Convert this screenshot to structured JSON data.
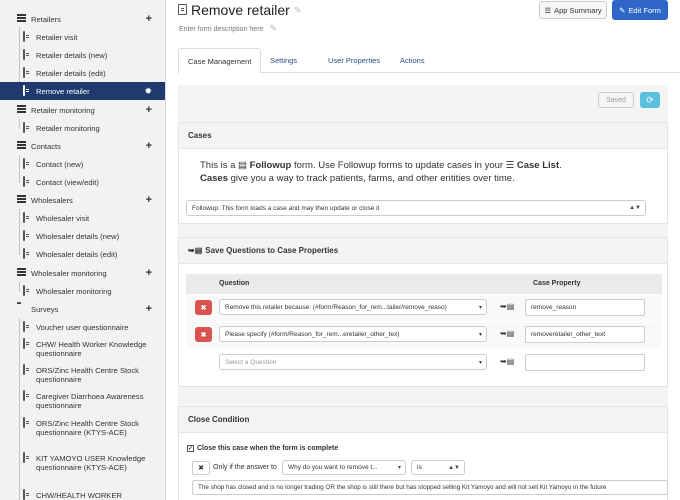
{
  "sidebar": {
    "items": [
      {
        "label": "Retailers",
        "type": "module"
      },
      {
        "label": "Retailer visit",
        "type": "form"
      },
      {
        "label": "Retailer details (new)",
        "type": "form"
      },
      {
        "label": "Retailer details (edit)",
        "type": "form"
      },
      {
        "label": "Remove retailer",
        "type": "form-active"
      },
      {
        "label": "Retailer monitoring",
        "type": "module"
      },
      {
        "label": "Retailer monitoring",
        "type": "form"
      },
      {
        "label": "Contacts",
        "type": "module"
      },
      {
        "label": "Contact (new)",
        "type": "form"
      },
      {
        "label": "Contact (view/edit)",
        "type": "form"
      },
      {
        "label": "Wholesalers",
        "type": "module"
      },
      {
        "label": "Wholesaler visit",
        "type": "form"
      },
      {
        "label": "Wholesaler details (new)",
        "type": "form"
      },
      {
        "label": "Wholesaler details (edit)",
        "type": "form"
      },
      {
        "label": "Wholesaler monitoring",
        "type": "module"
      },
      {
        "label": "Wholesaler monitoring",
        "type": "form"
      },
      {
        "label": "Surveys",
        "type": "folder"
      },
      {
        "label": "Voucher user questionnaire",
        "type": "form"
      },
      {
        "label": "CHW/ Health Worker Knowledge questionnaire",
        "type": "form"
      },
      {
        "label": "ORS/Zinc Health Centre Stock questionnaire",
        "type": "form"
      },
      {
        "label": "Caregiver Diarrhoea Awareness questionnaire",
        "type": "form"
      },
      {
        "label": "ORS/Zinc Health Centre Stock questionnaire (KTYS-ACE)",
        "type": "form"
      },
      {
        "label": "KIT YAMOYO USER Knowledge questionnaire (KTYS-ACE)",
        "type": "form"
      },
      {
        "label": "CHW/HEALTH WORKER",
        "type": "form"
      }
    ]
  },
  "header": {
    "title": "Remove retailer",
    "description_placeholder": "Enter form description here",
    "app_summary_label": "App Summary",
    "edit_form_label": "Edit Form"
  },
  "tabs": [
    {
      "label": "Case Management"
    },
    {
      "label": "Settings"
    },
    {
      "label": "User Properties"
    },
    {
      "label": "Actions"
    }
  ],
  "toolbar": {
    "saved_label": "Saved"
  },
  "cases": {
    "heading": "Cases",
    "line1_pre": "This is a",
    "line1_type": "Followup",
    "line1_mid": "form. Use Followup forms to update cases in your",
    "line1_case_list": "Case List",
    "line2_bold": "Cases",
    "line2_rest": "give you a way to track patients, farms, and other entities over time.",
    "type_select": "Followup: This form loads a case and may then update or close it"
  },
  "save_questions": {
    "heading": "Save Questions to Case Properties",
    "col_question": "Question",
    "col_property": "Case Property",
    "rows": [
      {
        "question": "Remove this retailer because: (#form/Reason_for_rem...tailer/remove_reaso)",
        "property": "remove_reason"
      },
      {
        "question": "Please specify (#form/Reason_for_rem...eretailer_other_tex)",
        "property": "removeretailer_other_text"
      }
    ],
    "new_row_placeholder": "Select a Question"
  },
  "close_condition": {
    "heading": "Close Condition",
    "checkbox_label": "Close this case when the form is complete",
    "only_if_label": "Only if the answer to",
    "question_select": "Why do you want to remove t...",
    "operator_select": "is",
    "answer_value": "The shop has closed and is no longer trading OR the shop is still there but has stopped selling Kit Yamoyo and will not sell Kit Yamoyo in the future"
  },
  "colors": {
    "active_nav": "#1e3a6e",
    "primary": "#2e67c8",
    "danger": "#d9534f",
    "info": "#5bc0de"
  }
}
